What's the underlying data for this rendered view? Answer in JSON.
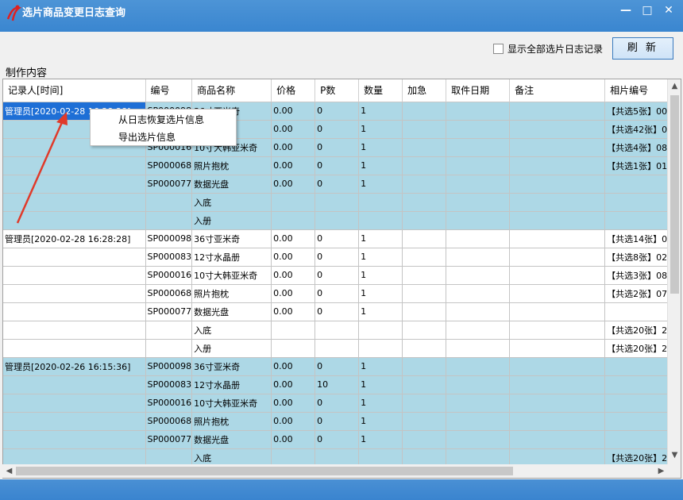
{
  "window": {
    "title": "选片商品变更日志查询",
    "controls": [
      "—",
      "□",
      "✕"
    ]
  },
  "toolbar": {
    "show_all_label": "显示全部选片日志记录",
    "refresh_label": "刷 新"
  },
  "section_label": "制作内容",
  "columns": [
    "记录人[时间]",
    "编号",
    "商品名称",
    "价格",
    "P数",
    "数量",
    "加急",
    "取件日期",
    "备注",
    "相片编号"
  ],
  "rows": [
    {
      "style": "blue",
      "recorder": "管理员[2020-02-28 16:28:28]",
      "selected": true,
      "code": "SP000098",
      "name": "36寸亚米奇",
      "price": "0.00",
      "p": "0",
      "qty": "1",
      "photo": "【共选5张】00"
    },
    {
      "style": "blue",
      "recorder": "",
      "code": "",
      "name": "",
      "price": "0.00",
      "p": "0",
      "qty": "1",
      "photo": "【共选42张】00"
    },
    {
      "style": "blue",
      "recorder": "",
      "code": "SP000016",
      "name": "10寸大韩亚米奇",
      "price": "0.00",
      "p": "0",
      "qty": "1",
      "photo": "【共选4张】08"
    },
    {
      "style": "blue",
      "recorder": "",
      "code": "SP000068",
      "name": "照片抱枕",
      "price": "0.00",
      "p": "0",
      "qty": "1",
      "photo": "【共选1张】01"
    },
    {
      "style": "blue",
      "recorder": "",
      "code": "SP000077",
      "name": "数据光盘",
      "price": "0.00",
      "p": "0",
      "qty": "1",
      "photo": ""
    },
    {
      "style": "blue",
      "recorder": "",
      "code": "",
      "name": "入底",
      "price": "",
      "p": "",
      "qty": "",
      "photo": ""
    },
    {
      "style": "blue",
      "recorder": "",
      "code": "",
      "name": "入册",
      "price": "",
      "p": "",
      "qty": "",
      "photo": ""
    },
    {
      "style": "white",
      "recorder": "管理员[2020-02-28 16:28:28]",
      "code": "SP000098",
      "name": "36寸亚米奇",
      "price": "0.00",
      "p": "0",
      "qty": "1",
      "photo": "【共选14张】00"
    },
    {
      "style": "white",
      "recorder": "",
      "code": "SP000083",
      "name": "12寸水晶册",
      "price": "0.00",
      "p": "0",
      "qty": "1",
      "photo": "【共选8张】02"
    },
    {
      "style": "white",
      "recorder": "",
      "code": "SP000016",
      "name": "10寸大韩亚米奇",
      "price": "0.00",
      "p": "0",
      "qty": "1",
      "photo": "【共选3张】08"
    },
    {
      "style": "white",
      "recorder": "",
      "code": "SP000068",
      "name": "照片抱枕",
      "price": "0.00",
      "p": "0",
      "qty": "1",
      "photo": "【共选2张】07"
    },
    {
      "style": "white",
      "recorder": "",
      "code": "SP000077",
      "name": "数据光盘",
      "price": "0.00",
      "p": "0",
      "qty": "1",
      "photo": ""
    },
    {
      "style": "white",
      "recorder": "",
      "code": "",
      "name": "入底",
      "price": "",
      "p": "",
      "qty": "",
      "photo": "【共选20张】2"
    },
    {
      "style": "white",
      "recorder": "",
      "code": "",
      "name": "入册",
      "price": "",
      "p": "",
      "qty": "",
      "photo": "【共选20张】2"
    },
    {
      "style": "blue",
      "recorder": "管理员[2020-02-26 16:15:36]",
      "code": "SP000098",
      "name": "36寸亚米奇",
      "price": "0.00",
      "p": "0",
      "qty": "1",
      "photo": ""
    },
    {
      "style": "blue",
      "recorder": "",
      "code": "SP000083",
      "name": "12寸水晶册",
      "price": "0.00",
      "p": "10",
      "qty": "1",
      "photo": ""
    },
    {
      "style": "blue",
      "recorder": "",
      "code": "SP000016",
      "name": "10寸大韩亚米奇",
      "price": "0.00",
      "p": "0",
      "qty": "1",
      "photo": ""
    },
    {
      "style": "blue",
      "recorder": "",
      "code": "SP000068",
      "name": "照片抱枕",
      "price": "0.00",
      "p": "0",
      "qty": "1",
      "photo": ""
    },
    {
      "style": "blue",
      "recorder": "",
      "code": "SP000077",
      "name": "数据光盘",
      "price": "0.00",
      "p": "0",
      "qty": "1",
      "photo": ""
    },
    {
      "style": "blue",
      "recorder": "",
      "code": "",
      "name": "入底",
      "price": "",
      "p": "",
      "qty": "",
      "photo": "【共选20张】2"
    }
  ],
  "context_menu": {
    "items": [
      "从日志恢复选片信息",
      "导出选片信息"
    ]
  },
  "colors": {
    "titlebar": "#3a86d0",
    "row_blue": "#add8e6",
    "selected": "#1e6fd6",
    "arrow": "#e03a2a"
  }
}
